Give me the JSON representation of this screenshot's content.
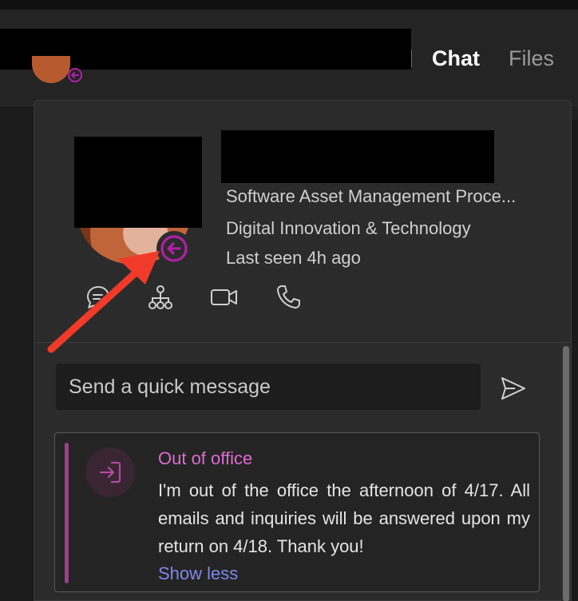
{
  "header": {
    "tabs": [
      {
        "label": "Chat",
        "active": true
      },
      {
        "label": "Files",
        "active": false
      }
    ]
  },
  "profile": {
    "job_title": "Software Asset Management Proce...",
    "department": "Digital Innovation & Technology",
    "last_seen": "Last seen 4h ago",
    "status_icon": "out-of-office-status-icon",
    "status_color": "#b01fa5"
  },
  "actions": [
    {
      "icon": "chat-icon"
    },
    {
      "icon": "org-chart-icon"
    },
    {
      "icon": "video-call-icon"
    },
    {
      "icon": "phone-call-icon"
    }
  ],
  "quick_message": {
    "placeholder": "Send a quick message",
    "send_icon": "send-icon"
  },
  "out_of_office": {
    "title": "Out of office",
    "message": "I'm out of the office the afternoon of 4/17. All emails and inquiries will be answered upon my return on 4/18. Thank you!",
    "toggle_label": "Show less",
    "accent_color": "#de6bd0",
    "link_color": "#7f86e8"
  },
  "annotation": {
    "arrow_color": "#f03a2a"
  }
}
